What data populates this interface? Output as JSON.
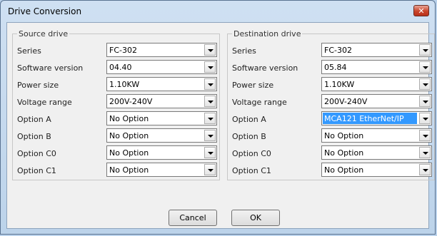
{
  "window": {
    "title": "Drive Conversion",
    "close_label": "✕"
  },
  "source": {
    "legend": "Source drive",
    "rows": [
      {
        "label": "Series",
        "value": "FC-302"
      },
      {
        "label": "Software version",
        "value": "04.40"
      },
      {
        "label": "Power size",
        "value": "1.10KW"
      },
      {
        "label": "Voltage range",
        "value": "200V-240V"
      },
      {
        "label": "Option A",
        "value": "No Option"
      },
      {
        "label": "Option B",
        "value": "No Option"
      },
      {
        "label": "Option C0",
        "value": "No Option"
      },
      {
        "label": "Option C1",
        "value": "No Option"
      }
    ]
  },
  "destination": {
    "legend": "Destination drive",
    "rows": [
      {
        "label": "Series",
        "value": "FC-302"
      },
      {
        "label": "Software version",
        "value": "05.84"
      },
      {
        "label": "Power size",
        "value": "1.10KW"
      },
      {
        "label": "Voltage range",
        "value": "200V-240V"
      },
      {
        "label": "Option A",
        "value": "MCA121 EtherNet/IP",
        "selected": true
      },
      {
        "label": "Option B",
        "value": "No Option"
      },
      {
        "label": "Option C0",
        "value": "No Option"
      },
      {
        "label": "Option C1",
        "value": "No Option"
      }
    ]
  },
  "buttons": {
    "cancel": "Cancel",
    "ok": "OK"
  }
}
